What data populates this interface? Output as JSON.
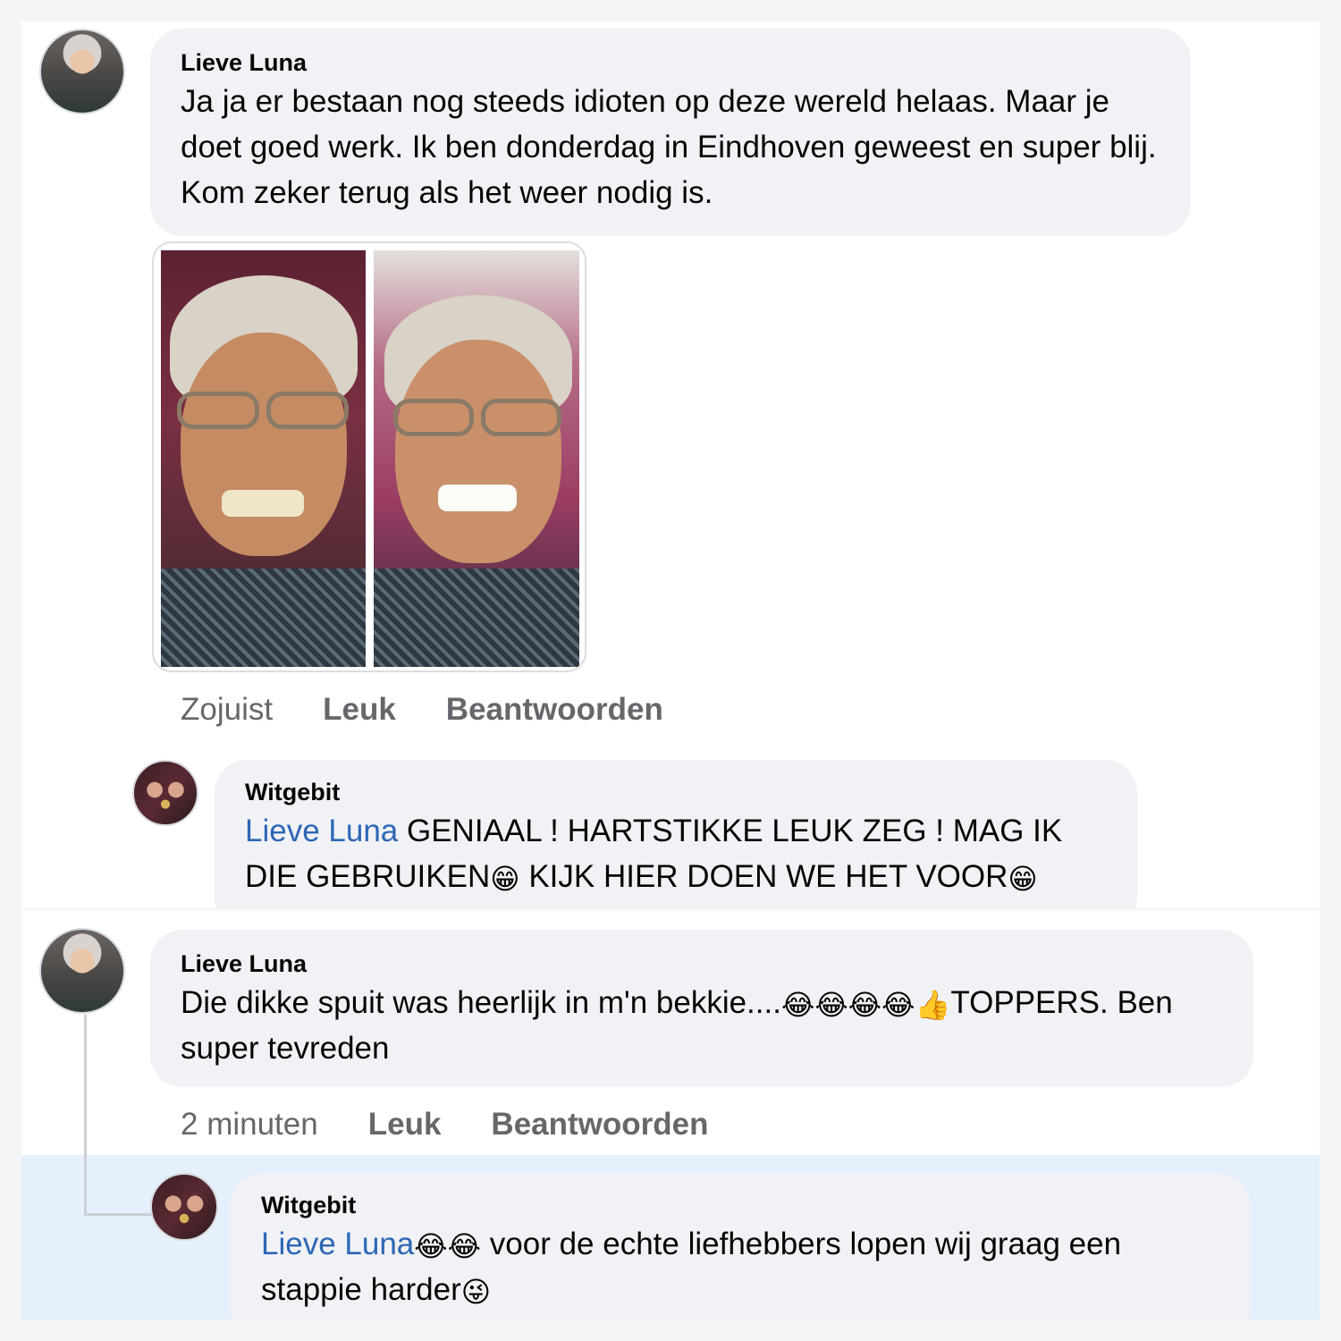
{
  "comments": [
    {
      "author": "Lieve Luna",
      "text": "Ja ja er bestaan nog steeds idioten op deze wereld helaas. Maar je doet goed werk. Ik ben donderdag in Eindhoven geweest en super blij. Kom zeker terug als het weer nodig is.",
      "time": "Zojuist",
      "like_label": "Leuk",
      "reply_label": "Beantwoorden",
      "photos": [
        "photo-before",
        "photo-after"
      ]
    },
    {
      "author": "Witgebit",
      "mention": "Lieve Luna",
      "text_1": " GENIAAL !  HARTSTIKKE LEUK ZEG ! MAG IK DIE GEBRUIKEN",
      "emoji_1": "😁",
      "text_2": " KIJK HIER DOEN WE HET VOOR",
      "emoji_2": "😁"
    },
    {
      "author": "Lieve Luna",
      "text_1": "Die dikke spuit was heerlijk in m'n bekkie....",
      "emojis": "😂😂😂😂👍",
      "text_2": "TOPPERS. Ben super tevreden",
      "time": "2 minuten",
      "like_label": "Leuk",
      "reply_label": "Beantwoorden"
    },
    {
      "author": "Witgebit",
      "mention": "Lieve Luna",
      "emojis": "😂😂",
      "text_1": " voor de echte liefhebbers lopen wij graag een stappie harder",
      "emoji_end": "😜"
    }
  ],
  "icons": {
    "avatar_luna": "avatar-photo",
    "avatar_witgebit": "avatar-logo"
  },
  "colors": {
    "mention": "#2d67b4",
    "bubble": "#f0f2f5",
    "highlight": "#e6f0fd",
    "meta": "#65676b"
  }
}
